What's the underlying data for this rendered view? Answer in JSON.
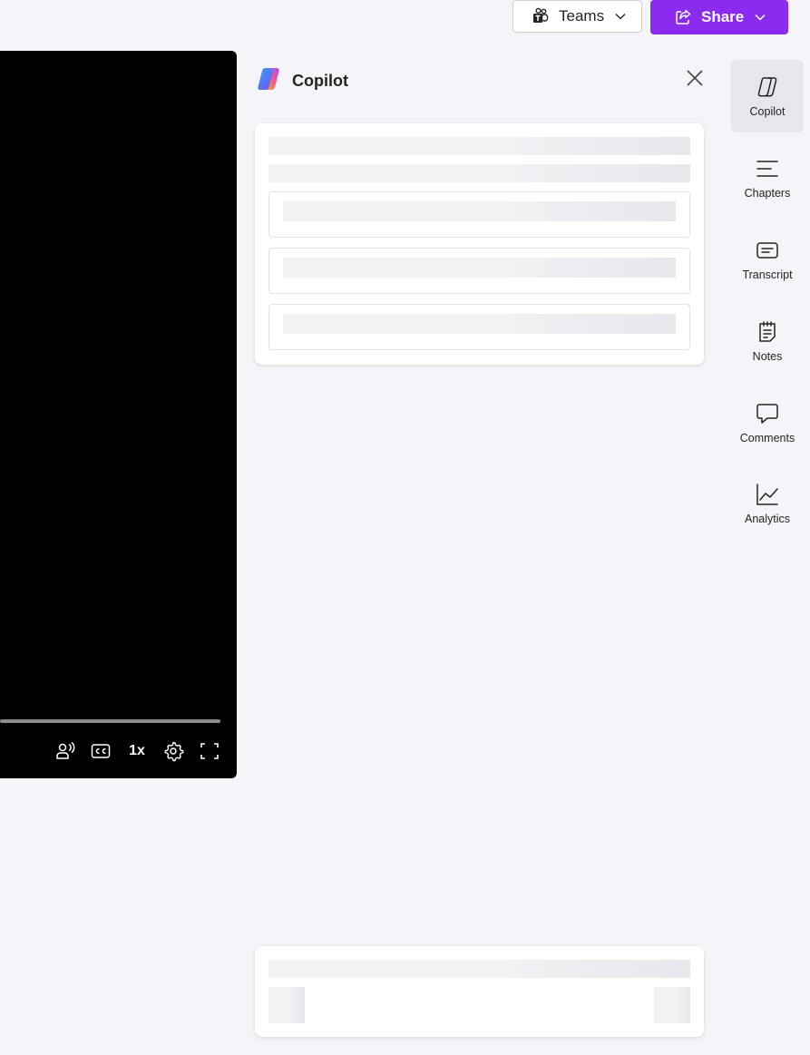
{
  "header": {
    "teams_label": "Teams",
    "share_label": "Share",
    "share_color": "#8b2bf0"
  },
  "player": {
    "speed_label": "1x",
    "controls": [
      "audio-description-icon",
      "closed-captions-icon",
      "speed",
      "settings-icon",
      "fullscreen-icon"
    ]
  },
  "copilot": {
    "title": "Copilot"
  },
  "rail": {
    "items": [
      {
        "label": "Copilot",
        "icon": "copilot-icon",
        "active": true
      },
      {
        "label": "Chapters",
        "icon": "chapters-icon"
      },
      {
        "label": "Transcript",
        "icon": "transcript-icon"
      },
      {
        "label": "Notes",
        "icon": "notes-icon"
      },
      {
        "label": "Comments",
        "icon": "comments-icon"
      },
      {
        "label": "Analytics",
        "icon": "analytics-icon"
      }
    ]
  }
}
